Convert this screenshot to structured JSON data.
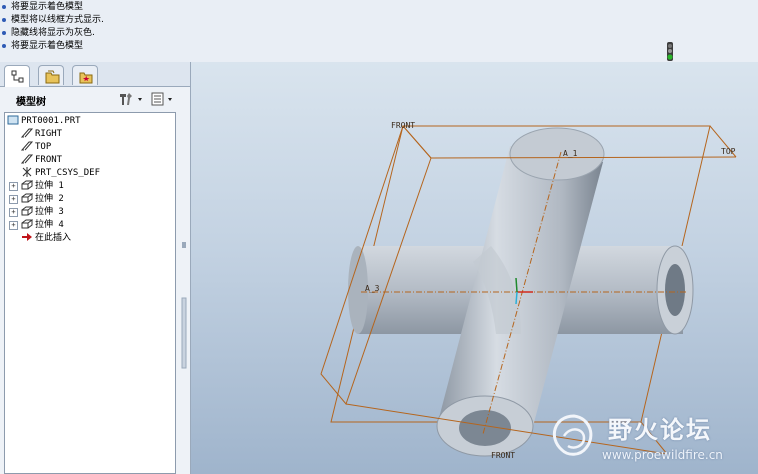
{
  "messages": [
    "将要显示着色模型",
    "模型将以线框方式显示.",
    "隐藏线将显示为灰色.",
    "将要显示着色模型"
  ],
  "tree": {
    "title": "模型树",
    "root": "PRT0001.PRT",
    "items": [
      {
        "label": "RIGHT",
        "icon": "datum-plane-icon"
      },
      {
        "label": "TOP",
        "icon": "datum-plane-icon"
      },
      {
        "label": "FRONT",
        "icon": "datum-plane-icon"
      },
      {
        "label": "PRT_CSYS_DEF",
        "icon": "coordinate-system-icon"
      },
      {
        "label": "拉伸 1",
        "icon": "extrude-icon"
      },
      {
        "label": "拉伸 2",
        "icon": "extrude-icon"
      },
      {
        "label": "拉伸 3",
        "icon": "extrude-icon"
      },
      {
        "label": "拉伸 4",
        "icon": "extrude-icon"
      },
      {
        "label": "在此插入",
        "icon": "insert-arrow-icon"
      }
    ]
  },
  "viewport": {
    "datum_labels": {
      "front": "FRONT",
      "top": "TOP",
      "axis_1": "A_1",
      "axis_3": "A_3",
      "front_bottom": "FRONT"
    }
  },
  "watermark": {
    "title": "野火论坛",
    "url": "www.proewildfire.cn"
  },
  "colors": {
    "datum_plane": "#b5651d",
    "model_body": "#b4bcc6",
    "accent": "#2f5bb5"
  }
}
